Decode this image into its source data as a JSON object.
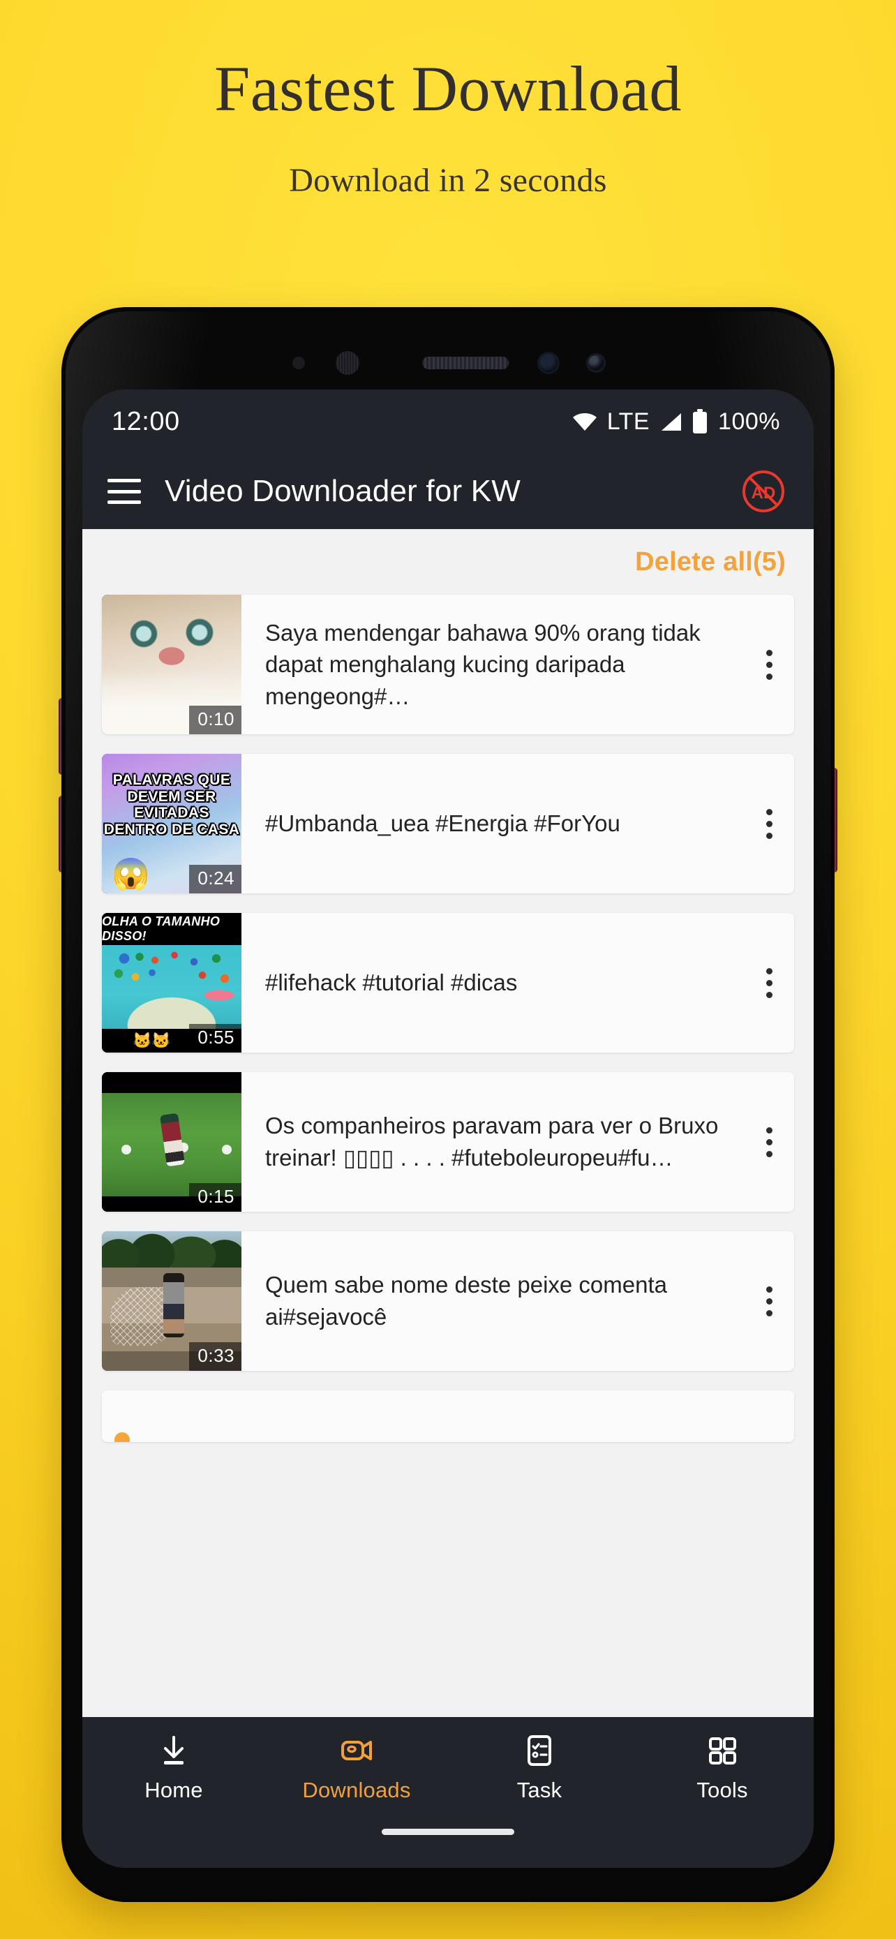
{
  "promo": {
    "headline": "Fastest Download",
    "subheadline": "Download in 2 seconds",
    "background_color": "#fdd92b",
    "text_color": "#332f2c"
  },
  "phone": {
    "frame_color": "#7c2a40",
    "screen_background": "#22242b"
  },
  "status_bar": {
    "time": "12:00",
    "wifi_icon": "wifi-icon",
    "network": "LTE",
    "signal_icon": "signal-icon",
    "battery_icon": "battery-icon",
    "battery_level": "100%"
  },
  "app_bar": {
    "menu_icon": "hamburger-menu-icon",
    "title": "Video Downloader for KW",
    "ad_block_icon": "no-ads-icon",
    "ad_block_label": "AD",
    "ad_block_color": "#e8392f"
  },
  "toolbar": {
    "delete_all_label": "Delete all(5)",
    "delete_all_color": "#f2a33c"
  },
  "downloads": {
    "count": 5,
    "items": [
      {
        "title": "Saya mendengar bahawa 90% orang tidak dapat menghalang kucing daripada mengeong#…",
        "duration": "0:10",
        "thumbnail": "cat-close-up-thumbnail",
        "menu_icon": "kebab-menu-icon"
      },
      {
        "title": "#Umbanda_uea #Energia #ForYou",
        "duration": "0:24",
        "thumbnail": "palavras-evitadas-thumbnail",
        "thumbnail_caption": "PALAVRAS QUE DEVEM SER EVITADAS DENTRO DE CASA",
        "thumbnail_emoji": "😱",
        "menu_icon": "kebab-menu-icon"
      },
      {
        "title": "#lifehack #tutorial #dicas",
        "duration": "0:55",
        "thumbnail": "lifehack-tutorial-thumbnail",
        "thumbnail_caption": "OLHA O TAMANHO DISSO!",
        "thumbnail_emoji": "🐱🐱",
        "menu_icon": "kebab-menu-icon"
      },
      {
        "title": "Os companheiros paravam para ver o Bruxo treinar! ▯▯▯▯ . . . . #futeboleuropeu#fu…",
        "duration": "0:15",
        "thumbnail": "soccer-training-thumbnail",
        "menu_icon": "kebab-menu-icon"
      },
      {
        "title": "Quem sabe nome deste peixe comenta ai#sejavocê",
        "duration": "0:33",
        "thumbnail": "fisherman-net-thumbnail",
        "menu_icon": "kebab-menu-icon"
      }
    ]
  },
  "bottom_nav": {
    "active": "Downloads",
    "active_color": "#f2a03c",
    "items": [
      {
        "label": "Home",
        "icon": "download-arrow-icon"
      },
      {
        "label": "Downloads",
        "icon": "video-camera-icon"
      },
      {
        "label": "Task",
        "icon": "checklist-icon"
      },
      {
        "label": "Tools",
        "icon": "grid-apps-icon"
      }
    ]
  }
}
